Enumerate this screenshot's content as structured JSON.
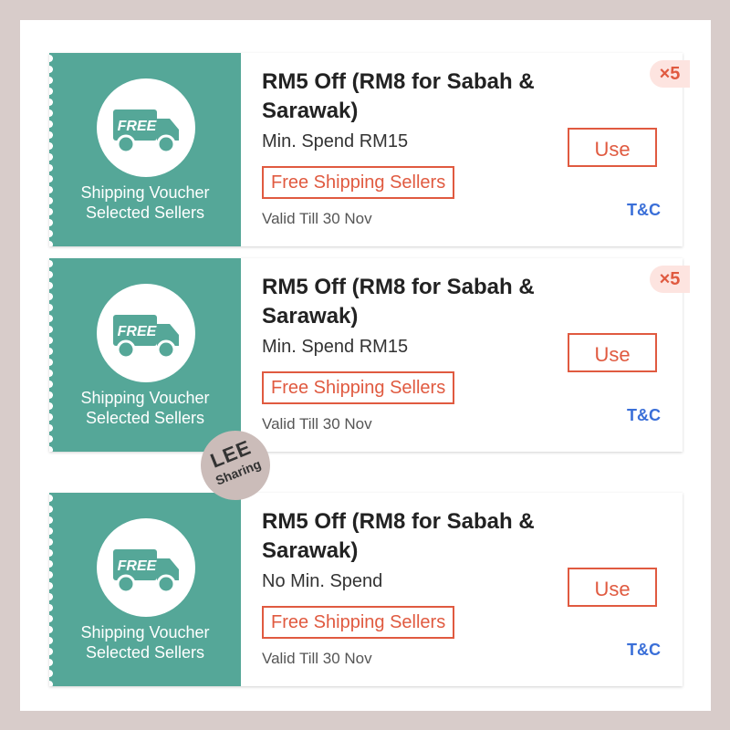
{
  "watermark": {
    "line1": "LEE",
    "line2": "Sharing"
  },
  "vouchers": [
    {
      "icon_text": "FREE",
      "left_line1": "Shipping Voucher",
      "left_line2": "Selected Sellers",
      "title": "RM5 Off (RM8 for Sabah & Sarawak)",
      "min_spend": "Min. Spend RM15",
      "tag": "Free Shipping Sellers",
      "valid": "Valid Till 30 Nov",
      "use_label": "Use",
      "tc_label": "T&C",
      "quantity_badge": "×5"
    },
    {
      "icon_text": "FREE",
      "left_line1": "Shipping Voucher",
      "left_line2": "Selected Sellers",
      "title": "RM5 Off (RM8 for Sabah & Sarawak)",
      "min_spend": "Min. Spend RM15",
      "tag": "Free Shipping Sellers",
      "valid": "Valid Till 30 Nov",
      "use_label": "Use",
      "tc_label": "T&C",
      "quantity_badge": "×5"
    },
    {
      "icon_text": "FREE",
      "left_line1": "Shipping Voucher",
      "left_line2": "Selected Sellers",
      "title": "RM5 Off (RM8 for Sabah & Sarawak)",
      "min_spend": "No Min. Spend",
      "tag": "Free Shipping Sellers",
      "valid": "Valid Till 30 Nov",
      "use_label": "Use",
      "tc_label": "T&C"
    }
  ],
  "colors": {
    "accent_green": "#55a798",
    "accent_red": "#e05a40",
    "link_blue": "#3a6fd8"
  }
}
